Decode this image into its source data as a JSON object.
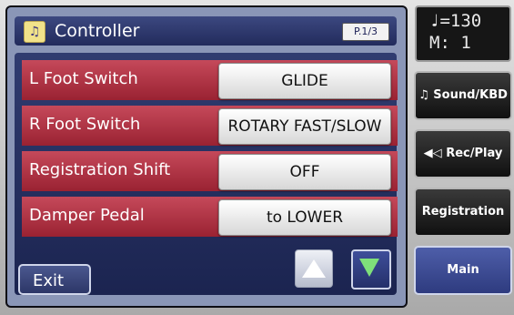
{
  "header": {
    "title": "Controller",
    "page_badge": "P.1/3",
    "icon": "music-note-icon"
  },
  "rows": [
    {
      "label": "L Foot Switch",
      "value": "GLIDE"
    },
    {
      "label": "R Foot Switch",
      "value": "ROTARY FAST/SLOW"
    },
    {
      "label": "Registration Shift",
      "value": "OFF"
    },
    {
      "label": "Damper Pedal",
      "value": "to LOWER"
    }
  ],
  "footer": {
    "exit_label": "Exit",
    "up_icon": "arrow-up-icon",
    "down_icon": "arrow-down-icon"
  },
  "side": {
    "tempo": "♩=130",
    "measure": "M:  1",
    "buttons": [
      {
        "label": "♫ Sound/KBD",
        "icon": "music-note-icon"
      },
      {
        "label": "◀◁ Rec/Play",
        "icon": "speaker-icon"
      },
      {
        "label": "Registration",
        "icon": "registration-icon"
      },
      {
        "label": "Main",
        "icon": ""
      }
    ]
  },
  "colors": {
    "row_bg": "#b0303f",
    "panel_bg": "#27325f",
    "lcd_bg": "#8a96b7",
    "arrow_down": "#7fe07a"
  }
}
